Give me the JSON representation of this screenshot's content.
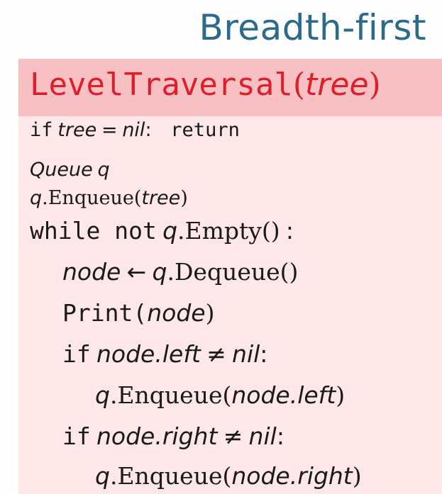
{
  "slide": {
    "title": "Breadth-first"
  },
  "algorithm": {
    "name_code": "LevelTraversal",
    "param": "tree",
    "open_paren": "(",
    "close_paren": ")",
    "lines": {
      "l1": {
        "kw_if": "if",
        "var": "tree",
        "op": "=",
        "val": "nil",
        "colon": ":",
        "kw_return": "return"
      },
      "l2": {
        "type": "Queue",
        "var": "q"
      },
      "l3": {
        "obj": "q",
        "method": ".Enqueue(",
        "arg": "tree",
        "close": ")"
      },
      "l4": {
        "kw_while": "while not",
        "obj": "q",
        "method": ".Empty()",
        "colon": ":"
      },
      "l5": {
        "var": "node",
        "arrow": "←",
        "obj": "q",
        "method": ".Dequeue()"
      },
      "l6": {
        "fn": "Print(",
        "arg": "node",
        "close": ")"
      },
      "l7": {
        "kw_if": "if",
        "expr": "node.left",
        "op": "≠",
        "val": "nil",
        "colon": ":"
      },
      "l8": {
        "obj": "q",
        "method": ".Enqueue(",
        "arg": "node.left",
        "close": ")"
      },
      "l9": {
        "kw_if": "if",
        "expr": "node.right",
        "op": "≠",
        "val": "nil",
        "colon": ":"
      },
      "l10": {
        "obj": "q",
        "method": ".Enqueue(",
        "arg": "node.right",
        "close": ")"
      }
    }
  },
  "colors": {
    "title": "#2c6a8b",
    "header_bg": "#f9c0c4",
    "box_bg": "#fde7e8",
    "name": "#dc1f2a"
  }
}
